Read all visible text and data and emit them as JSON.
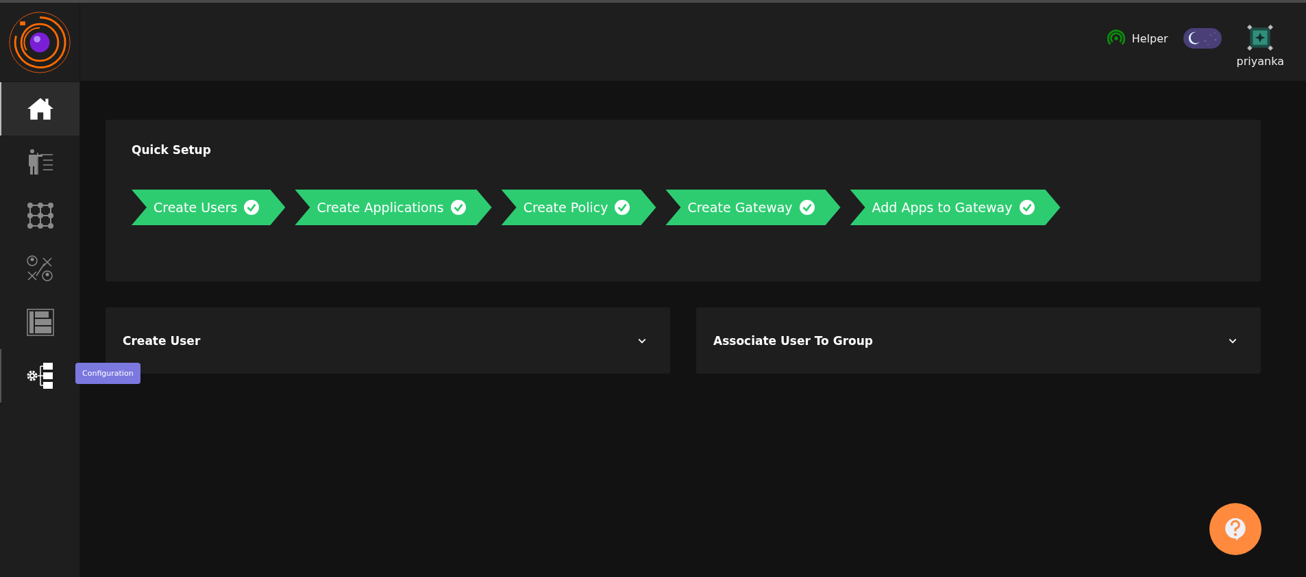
{
  "sidebar": {
    "items": [
      {
        "kind": "home",
        "selected": true,
        "hovered": false
      },
      {
        "kind": "presenter",
        "selected": false,
        "hovered": false
      },
      {
        "kind": "grid",
        "selected": false,
        "hovered": false
      },
      {
        "kind": "network",
        "selected": false,
        "hovered": false
      },
      {
        "kind": "document",
        "selected": false,
        "hovered": false
      },
      {
        "kind": "config",
        "selected": false,
        "hovered": true
      }
    ],
    "tooltip": "Configuration"
  },
  "header": {
    "helper": "Helper",
    "theme_toggle": {
      "on": true
    },
    "user": "priyanka"
  },
  "quick_setup": {
    "title": "Quick Setup",
    "steps": [
      {
        "label": "Create Users",
        "done": true
      },
      {
        "label": "Create Applications",
        "done": true
      },
      {
        "label": "Create Policy",
        "done": true
      },
      {
        "label": "Create Gateway",
        "done": true
      },
      {
        "label": "Add Apps to Gateway",
        "done": true
      }
    ]
  },
  "panels": [
    {
      "title": "Create User",
      "expanded": false
    },
    {
      "title": "Associate User To Group",
      "expanded": false
    }
  ]
}
